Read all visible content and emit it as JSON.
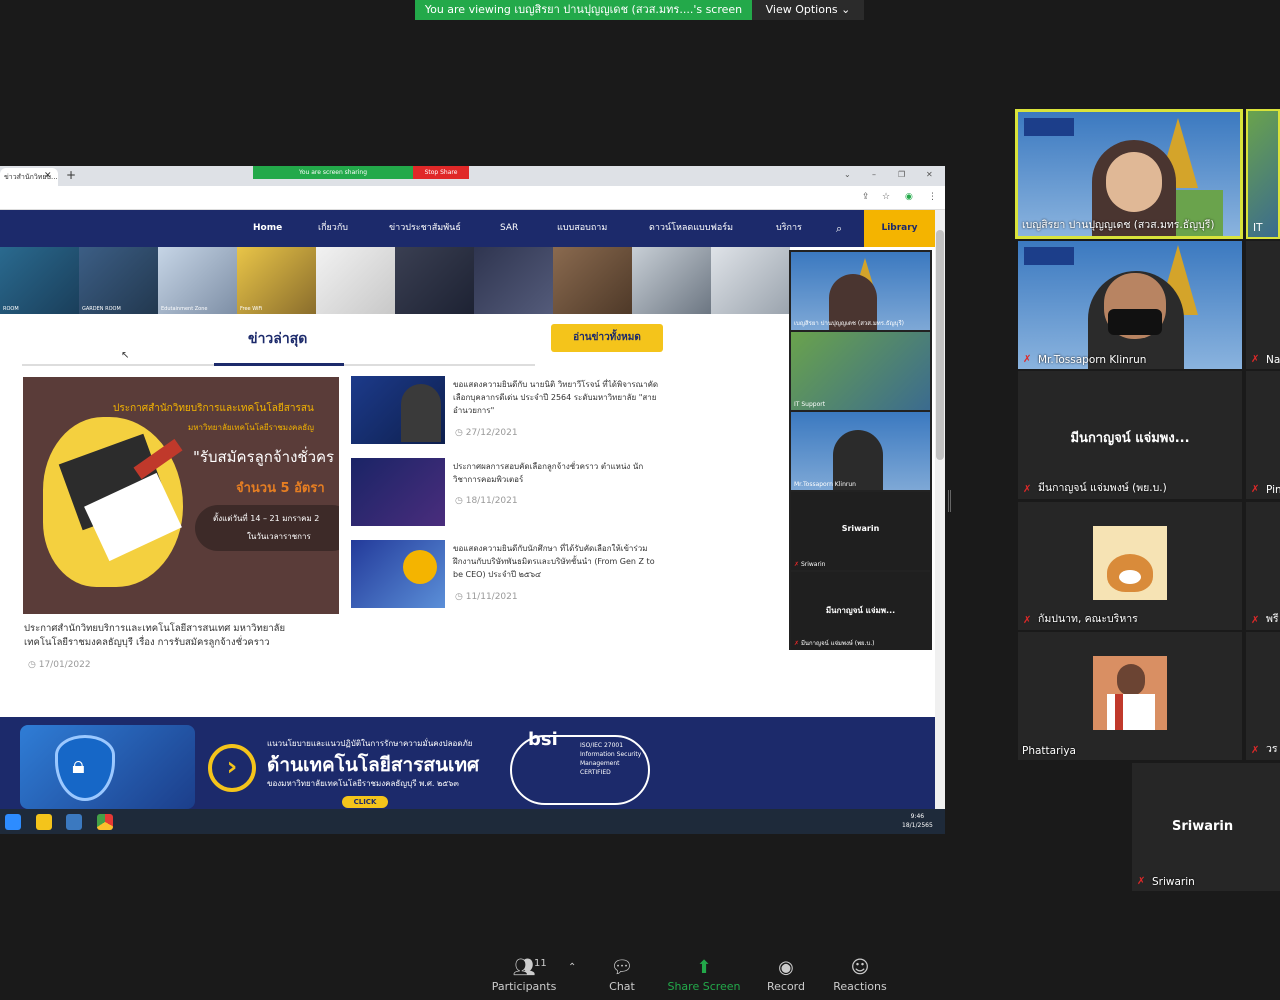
{
  "zoom": {
    "viewing_banner": "You are viewing เบญสิรยา ปานปุญญเดช (สวส.มทร....'s screen",
    "view_options": "View Options ⌄",
    "toolbar": {
      "participants_label": "Participants",
      "participants_count": "11",
      "chat_label": "Chat",
      "share_label": "Share Screen",
      "record_label": "Record",
      "reactions_label": "Reactions"
    }
  },
  "shared_screen": {
    "browser": {
      "tab_title": "ข่าวสำนักวิทยบ...",
      "sharing_text": "You are screen sharing",
      "stop_share": "Stop Share"
    },
    "site": {
      "nav": [
        "Home",
        "เกี่ยวกับ",
        "ข่าวประชาสัมพันธ์",
        "SAR",
        "แบบสอบถาม",
        "ดาวน์โหลดแบบฟอร์ม",
        "บริการ"
      ],
      "library": "Library",
      "photos": [
        {
          "label": "ROOM"
        },
        {
          "label": "GARDEN ROOM"
        },
        {
          "label": "Edutainment Zone"
        },
        {
          "label": "Free WiFi"
        },
        {
          "label": ""
        },
        {
          "label": ""
        },
        {
          "label": ""
        },
        {
          "label": ""
        },
        {
          "label": ""
        },
        {
          "label": ""
        }
      ],
      "news_heading": "ข่าวล่าสุด",
      "read_all": "อ่านข่าวทั้งหมด",
      "feature": {
        "img_line1": "ประกาศสำนักวิทยบริการและเทคโนโลยีสารสน",
        "img_line2": "มหาวิทยาลัยเทคโนโลยีราชมงคลธัญ",
        "img_line3": "\"รับสมัครลูกจ้างชั่วคร",
        "img_line4": "จำนวน 5 อัตรา",
        "img_line5": "ตั้งแต่วันที่ 14 – 21 มกราคม 2",
        "img_line6": "ในวันเวลาราชการ",
        "title": "ประกาศสำนักวิทยบริการและเทคโนโลยีสารสนเทศ มหาวิทยาลัยเทคโนโลยีราชมงคลธัญบุรี เรื่อง การรับสมัครลูกจ้างชั่วคราว",
        "date": "17/01/2022"
      },
      "news": [
        {
          "text": "ขอแสดงความยินดีกับ นายนิติ วิทยาวีโรจน์ ที่ได้พิจารณาคัดเลือกบุคลากรดีเด่น ประจำปี 2564 ระดับมหาวิทยาลัย \"สายอำนวยการ\"",
          "date": "27/12/2021"
        },
        {
          "text": "ประกาศผลการสอบคัดเลือกลูกจ้างชั่วคราว ตำแหน่ง นักวิชาการคอมพิวเตอร์",
          "date": "18/11/2021"
        },
        {
          "text": "ขอแสดงความยินดีกับนักศึกษา ที่ได้รับคัดเลือกให้เข้าร่วมฝึกงานกับบริษัทพันธมิตรและบริษัทชั้นนำ (From Gen Z to be CEO) ประจำปี ๒๕๖๔",
          "date": "11/11/2021"
        }
      ],
      "banner": {
        "line1": "แนวนโยบายและแนวปฏิบัติในการรักษาความมั่นคงปลอดภัย",
        "line2": "ด้านเทคโนโลยีสารสนเทศ",
        "line3": "ของมหาวิทยาลัยเทคโนโลยีราชมงคลธัญบุรี พ.ศ. ๒๕๖๓",
        "click": "CLICK",
        "bsi": "bsi",
        "iso": "ISO/IEC 27001 Information Security Management CERTIFIED"
      },
      "clock_time": "9:46",
      "clock_date": "18/1/2565"
    },
    "inner_gallery": [
      {
        "name": "เบญสิรยา ปานปุญญเดช (สวส.มทร.ธัญบุรี)",
        "center": ""
      },
      {
        "name": "IT Support",
        "center": ""
      },
      {
        "name": "Mr.Tossaporn Klinrun",
        "center": ""
      },
      {
        "name": "Sriwarin",
        "center": "Sriwarin"
      },
      {
        "name": "มีนกาญจน์ แจ่มพงษ์ (พย.บ.)",
        "center": "มีนกาญจน์ แจ่มพ..."
      }
    ]
  },
  "participants": [
    {
      "name": "เบญสิรยา ปานปุญญเดช (สวส.มทร.ธัญบุรี)",
      "center": ""
    },
    {
      "name": "IT",
      "center": ""
    },
    {
      "name": "Mr.Tossaporn Klinrun",
      "center": ""
    },
    {
      "name": "Na",
      "center": ""
    },
    {
      "name": "มีนกาญจน์ แจ่มพงษ์ (พย.บ.)",
      "center": "มีนกาญจน์ แจ่มพง..."
    },
    {
      "name": "Pin",
      "center": ""
    },
    {
      "name": "กัมปนาท, คณะบริหาร",
      "center": ""
    },
    {
      "name": "พรี",
      "center": ""
    },
    {
      "name": "Phattariya",
      "center": ""
    },
    {
      "name": "วร",
      "center": ""
    },
    {
      "name": "Sriwarin",
      "center": "Sriwarin"
    }
  ],
  "colors": {
    "zoom_green": "#23a94a",
    "site_navy": "#1c2a6b",
    "site_yellow": "#f4c41b",
    "active_speaker": "#d9e33b",
    "muted_red": "#e02828"
  }
}
